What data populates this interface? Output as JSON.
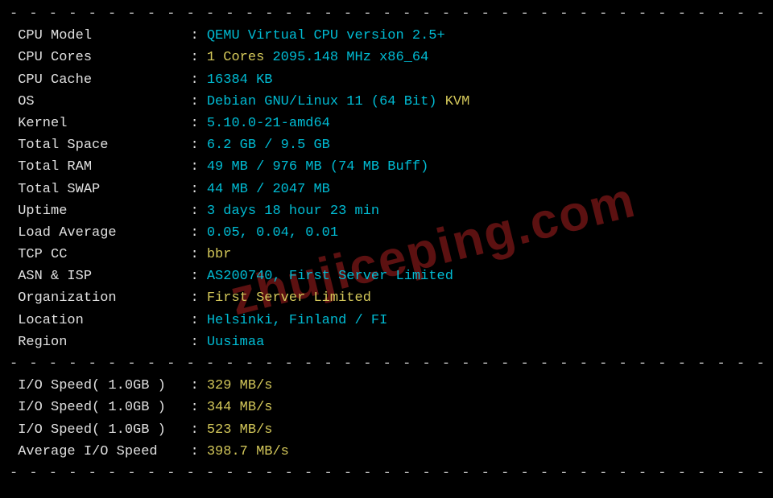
{
  "labels": {
    "cpu_model": "CPU Model",
    "cpu_cores": "CPU Cores",
    "cpu_cache": "CPU Cache",
    "os": "OS",
    "kernel": "Kernel",
    "total_space": "Total Space",
    "total_ram": "Total RAM",
    "total_swap": "Total SWAP",
    "uptime": "Uptime",
    "load_average": "Load Average",
    "tcp_cc": "TCP CC",
    "asn_isp": "ASN & ISP",
    "organization": "Organization",
    "location": "Location",
    "region": "Region",
    "io_speed": "I/O Speed( 1.0GB )",
    "avg_io_speed": "Average I/O Speed"
  },
  "values": {
    "cpu_model": "QEMU Virtual CPU version 2.5+",
    "cpu_cores_count": "1 Cores",
    "cpu_cores_freq": " 2095.148 MHz x86_64",
    "cpu_cache": "16384 KB",
    "os_main": "Debian GNU/Linux 11 (64 Bit)",
    "os_virt": " KVM",
    "kernel": "5.10.0-21-amd64",
    "total_space": "6.2 GB / 9.5 GB",
    "total_ram": "49 MB / 976 MB (74 MB Buff)",
    "total_swap": "44 MB / 2047 MB",
    "uptime": "3 days 18 hour 23 min",
    "load_average": "0.05, 0.04, 0.01",
    "tcp_cc": "bbr",
    "asn_isp": "AS200740, First Server Limited",
    "organization": "First Server Limited",
    "location": "Helsinki, Finland / FI",
    "region": "Uusimaa",
    "io_speed_1": "329 MB/s",
    "io_speed_2": "344 MB/s",
    "io_speed_3": "523 MB/s",
    "avg_io_speed": "398.7 MB/s"
  },
  "watermark": "zhujiceping.com",
  "divider": "- - - - - - - - - - - - - - - - - - - - - - - - - - - - - - - - - - - - - - - - - - - - - - - - - - - - - - - - - - - - - - - - - - - - - - -"
}
